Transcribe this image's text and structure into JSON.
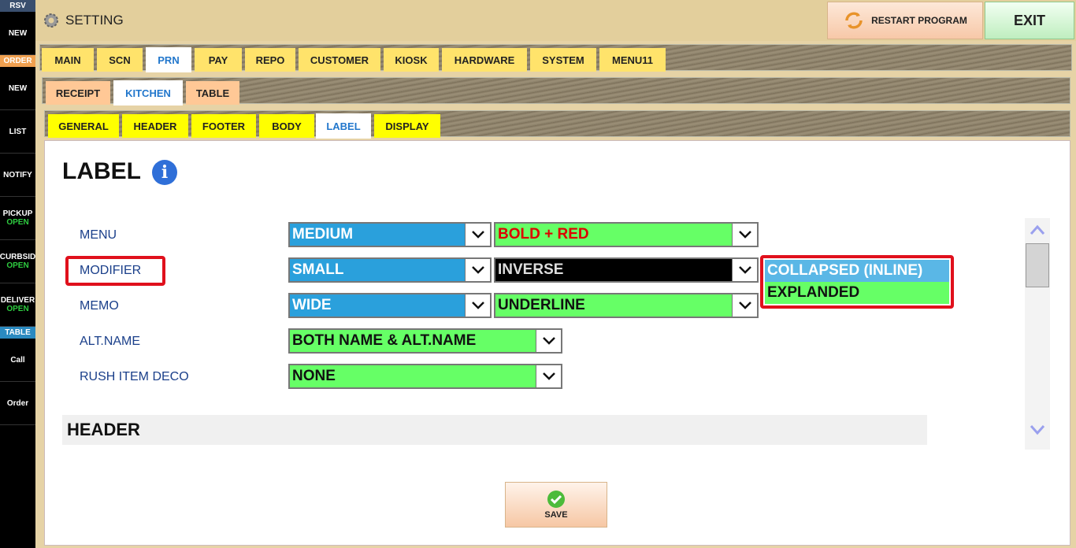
{
  "sidebar": {
    "rsv_header": "RSV",
    "order_header": "ORDER",
    "table_header": "TABLE",
    "items": [
      {
        "label": "NEW",
        "sub": ""
      },
      {
        "label": "NEW",
        "sub": ""
      },
      {
        "label": "LIST",
        "sub": ""
      },
      {
        "label": "NOTIFY",
        "sub": ""
      },
      {
        "label": "PICKUP",
        "sub": "OPEN"
      },
      {
        "label": "CURBSID",
        "sub": "OPEN"
      },
      {
        "label": "DELIVER",
        "sub": "OPEN"
      },
      {
        "label": "Call",
        "sub": ""
      },
      {
        "label": "Order",
        "sub": ""
      }
    ]
  },
  "titlebar": {
    "title": "SETTING",
    "restart_label": "RESTART PROGRAM",
    "exit_label": "EXIT"
  },
  "tabs_l1": [
    "MAIN",
    "SCN",
    "PRN",
    "PAY",
    "REPO",
    "CUSTOMER",
    "KIOSK",
    "HARDWARE",
    "SYSTEM",
    "MENU11"
  ],
  "tabs_l2": [
    "RECEIPT",
    "KITCHEN",
    "TABLE"
  ],
  "tabs_l3": [
    "GENERAL",
    "HEADER",
    "FOOTER",
    "BODY",
    "LABEL",
    "DISPLAY"
  ],
  "active": {
    "l1": "PRN",
    "l2": "KITCHEN",
    "l3": "LABEL"
  },
  "content": {
    "page_title": "LABEL",
    "rows": [
      {
        "label": "MENU",
        "size": "MEDIUM",
        "style": "BOLD + RED"
      },
      {
        "label": "MODIFIER",
        "size": "SMALL",
        "style": "INVERSE"
      },
      {
        "label": "MEMO",
        "size": "WIDE",
        "style": "UNDERLINE"
      },
      {
        "label": "ALT.NAME",
        "value": "BOTH NAME & ALT.NAME"
      },
      {
        "label": "RUSH ITEM DECO",
        "value": "NONE"
      }
    ],
    "dropdown_options": [
      "COLLAPSED (INLINE)",
      "EXPLANDED"
    ],
    "section_header": "HEADER",
    "save_label": "SAVE"
  },
  "colors": {
    "select_blue": "#2aa0dc",
    "select_green": "#66ff66",
    "highlight_red": "#e0101c",
    "active_tab_text": "#2277cc"
  }
}
